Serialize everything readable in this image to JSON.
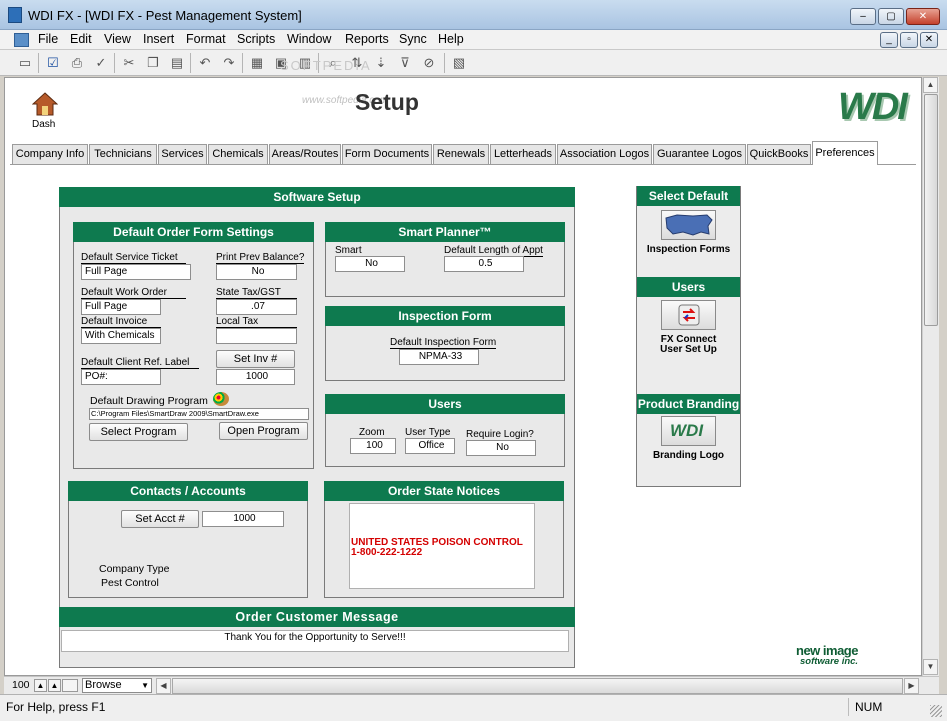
{
  "window": {
    "title": "WDI FX - [WDI FX - Pest Management System]",
    "minimize": "–",
    "maximize": "▢",
    "close": "✕"
  },
  "menu": [
    "File",
    "Edit",
    "View",
    "Insert",
    "Format",
    "Scripts",
    "Window",
    "Reports",
    "Sync",
    "Help"
  ],
  "mdi_controls": [
    "_",
    "▫",
    "✕"
  ],
  "header": {
    "dash_label": "Dash",
    "page_title": "Setup",
    "watermark": "SOFTPEDIA",
    "watermark_url": "www.softpedia.com",
    "logo": "WDI"
  },
  "tabs": [
    "Company Info",
    "Technicians",
    "Services",
    "Chemicals",
    "Areas/Routes",
    "Form Documents",
    "Renewals",
    "Letterheads",
    "Association Logos",
    "Guarantee Logos",
    "QuickBooks",
    "Preferences"
  ],
  "software_setup": {
    "title": "Software Setup",
    "order_form": {
      "title": "Default Order Form Settings",
      "service_ticket_label": "Default Service Ticket",
      "service_ticket_value": "Full Page",
      "print_prev_label": "Print Prev Balance?",
      "print_prev_value": "No",
      "work_order_label": "Default Work Order",
      "work_order_value": "Full Page",
      "state_tax_label": "State Tax/GST",
      "state_tax_value": ".07",
      "invoice_label": "Default Invoice",
      "invoice_value": "With Chemicals",
      "local_tax_label": "Local Tax",
      "local_tax_value": "",
      "client_ref_label": "Default Client Ref. Label",
      "client_ref_value": "PO#:",
      "set_inv_button": "Set Inv #",
      "inv_value": "1000",
      "drawing_label": "Default Drawing Program",
      "drawing_path": "C:\\Program Files\\SmartDraw 2009\\SmartDraw.exe",
      "select_program": "Select Program",
      "open_program": "Open Program"
    },
    "smart_planner": {
      "title": "Smart Planner™",
      "sp_label": "Smart Planner™",
      "sp_value": "No",
      "appt_label": "Default Length of Appt",
      "appt_value": "0.5"
    },
    "inspection_form": {
      "title": "Inspection Form",
      "label": "Default Inspection Form",
      "value": "NPMA-33"
    },
    "users": {
      "title": "Users",
      "zoom_label": "Zoom",
      "zoom_value": "100",
      "type_label": "User Type",
      "type_value": "Office",
      "login_label": "Require Login?",
      "login_value": "No"
    },
    "contacts": {
      "title": "Contacts / Accounts",
      "set_acct_button": "Set Acct #",
      "acct_value": "1000",
      "company_type_label": "Company Type",
      "company_type_value": "Pest Control"
    },
    "state_notices": {
      "title": "Order State Notices",
      "line1": "UNITED STATES POISON CONTROL",
      "line2": "1-800-222-1222",
      "color": "#d40000"
    },
    "customer_message": {
      "title": "Order Customer Message",
      "value": "Thank You for the Opportunity to Serve!!!"
    }
  },
  "sidebar": {
    "select_default_title": "Select Default",
    "inspection_forms_label": "Inspection Forms",
    "users_title": "Users",
    "fx_connect_label1": "FX Connect",
    "fx_connect_label2": "User Set Up",
    "branding_title": "Product Branding",
    "branding_icon_text": "WDI",
    "branding_label": "Branding Logo"
  },
  "company_logo": {
    "line1": "new image",
    "line2": "software inc."
  },
  "bottom_bar": {
    "zoom": "100",
    "mode": "Browse"
  },
  "status": {
    "help": "For Help, press F1",
    "num": "NUM"
  },
  "colors": {
    "accent_green": "#0e7a4f",
    "notice_red": "#d40000"
  }
}
